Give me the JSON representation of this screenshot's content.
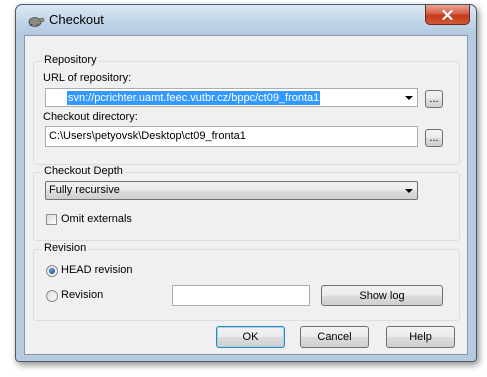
{
  "window": {
    "title": "Checkout"
  },
  "repository": {
    "group_label": "Repository",
    "url_label": "URL of repository:",
    "url_value": "svn://pcrichter.uamt.feec.vutbr.cz/bppc/ct09_fronta1",
    "dir_label": "Checkout directory:",
    "dir_value": "C:\\Users\\petyovsk\\Desktop\\ct09_fronta1",
    "browse_label": "..."
  },
  "depth": {
    "group_label": "Checkout Depth",
    "selected": "Fully recursive",
    "omit_label": "Omit externals"
  },
  "revision": {
    "group_label": "Revision",
    "head_label": "HEAD revision",
    "revision_label": "Revision",
    "revision_value": "",
    "show_log_label": "Show log"
  },
  "buttons": {
    "ok": "OK",
    "cancel": "Cancel",
    "help": "Help"
  }
}
